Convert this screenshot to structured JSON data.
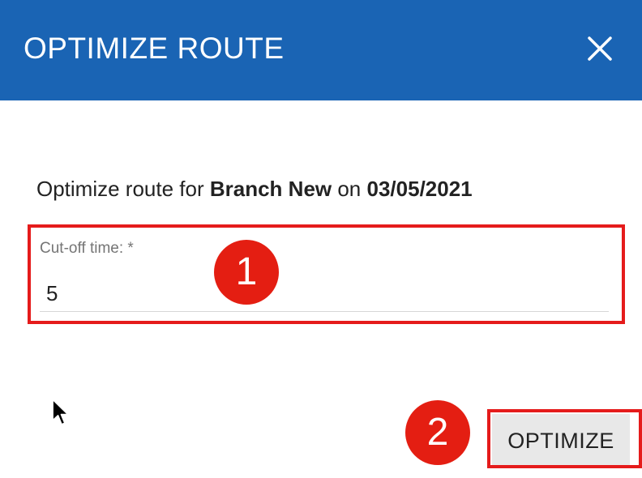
{
  "dialog": {
    "title": "OPTIMIZE ROUTE",
    "close_icon": "close-icon"
  },
  "subtitle": {
    "prefix": "Optimize route for ",
    "branch": "Branch New",
    "middle": " on ",
    "date": "03/05/2021"
  },
  "form": {
    "cutoff_label": "Cut-off time: *",
    "cutoff_value": "5"
  },
  "actions": {
    "optimize_label": "OPTIMIZE"
  },
  "annotations": {
    "badge_1": "1",
    "badge_2": "2",
    "highlight_color": "#e51b1b",
    "badge_color": "#e41e12"
  },
  "colors": {
    "header": "#1a64b4",
    "button_bg": "#e8e8e8"
  }
}
